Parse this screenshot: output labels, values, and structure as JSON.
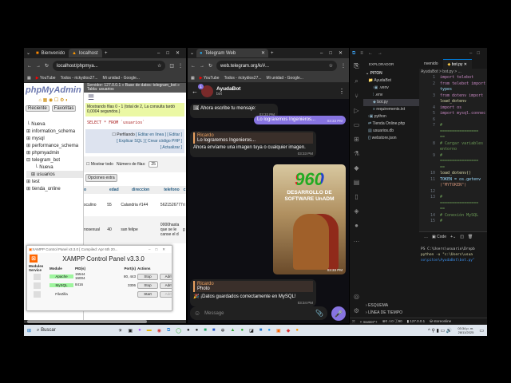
{
  "pma_window": {
    "tabs": [
      {
        "label": "Bienvenido"
      },
      {
        "label": "localhost"
      }
    ],
    "url": "localhost/phpmya...",
    "bookmarks": [
      "YouTube",
      "Todos - rickydios27...",
      "Mi unidad - Google..."
    ],
    "logo": "phpMyAdmin",
    "side_tabs": [
      "Reciente",
      "Favoritas"
    ],
    "tree": [
      "Nueva",
      "information_schema",
      "mysql",
      "performance_schema",
      "phpmyadmin",
      "telegram_bot",
      "Nueva",
      "usuarios",
      "test",
      "tienda_online"
    ],
    "breadcrumb": "Servidor: 127.0.0.1 » Base de datos: telegram_bot » Tabla: usuarios",
    "query_msg": "Mostrando filas 0 - 1 (total de 2, La consulta tardó 0,0004 segundos.)",
    "sql": "SELECT * FROM `usuarios`",
    "profiling": "Perfilando",
    "links": [
      "[ Editar en línea ]",
      "[ Editar ]",
      "[ Explicar SQL ]",
      "[ Crear código PHP ]",
      "[ Actualizar ]"
    ],
    "show_all": "Mostrar todo",
    "rows_label": "Número de filas:",
    "rows_value": "25",
    "extra_options": "Opciones extra",
    "columns": [
      "o",
      "edad",
      "direccion",
      "telefono",
      "c"
    ],
    "rows": [
      [
        "sculino",
        "55",
        "Calandria #144",
        "5621526777",
        "ri"
      ],
      [
        "nosexual",
        "40",
        "san felipe",
        "0000hasta que se le canse el d",
        "g"
      ]
    ]
  },
  "xampp": {
    "title": "XAMPP Control Panel v3.3.0   [ Compiled: Apr 6th 20...",
    "heading": "XAMPP Control Panel v3.3.0",
    "headers": [
      "Modules Service",
      "Module",
      "PID(s)",
      "Port(s)",
      "Actions"
    ],
    "rows": [
      {
        "module": "Apache",
        "pid": "15544\n16004",
        "ports": "80, 443",
        "action": "Stop",
        "admin": "Admin",
        "running": true
      },
      {
        "module": "MySQL",
        "pid": "8416",
        "ports": "3306",
        "action": "Stop",
        "admin": "Admin",
        "running": true
      },
      {
        "module": "FileZilla",
        "pid": "",
        "ports": "",
        "action": "Start",
        "admin": "Admin",
        "running": false
      }
    ]
  },
  "tg_window": {
    "tab": "Telegram Web",
    "url": "web.telegram.org/k/#...",
    "bookmarks": [
      "YouTube",
      "Todos - rickydios27...",
      "Mi unidad - Google..."
    ],
    "chat_name": "AyudaBot",
    "chat_status": "bot",
    "unread": "1",
    "messages": [
      {
        "text": "Ahora escribe tu mensaje:",
        "time": "03:33 PM"
      },
      {
        "text": "Lo lograremos Ingenieros...",
        "time": "03:33 PM"
      },
      {
        "reply_name": "Ricardo",
        "reply_text": "Lo lograremos Ingenieros...",
        "text": "Ahora envíame una imagen tuya o cualquier imagen.",
        "time": "03:33 PM"
      },
      {
        "image_title": "960",
        "image_caption": "DESARROLLO DE SOFTWARE UnADM",
        "time": "03:33 PM"
      },
      {
        "reply_name": "Ricardo",
        "reply_text": "Photo",
        "text": "¡Datos guardados correctamente en MySQL!",
        "time": "03:34 PM"
      }
    ],
    "input_placeholder": "Message"
  },
  "vscode": {
    "tabs": [
      "nvenido",
      "bot.py"
    ],
    "explorer_title": "EXPLORADOR",
    "root": "PITON",
    "tree": [
      "AyudaBot",
      ".venv",
      ".env",
      "bot.py",
      "requirements.txt",
      "python",
      "Tienda Online.php",
      "usuarios.db",
      "webstore.json"
    ],
    "breadcrumb": "AyudaBot > bot.py > ...",
    "code": [
      [
        "1",
        "import telebot"
      ],
      [
        "2",
        "from telebot import"
      ],
      [
        "",
        "types"
      ],
      [
        "3",
        "from dotenv import"
      ],
      [
        "",
        "load_dotenv"
      ],
      [
        "4",
        "import os"
      ],
      [
        "5",
        "import mysql.connec"
      ],
      [
        "6",
        ""
      ],
      [
        "7",
        "#"
      ],
      [
        "",
        "================"
      ],
      [
        "",
        "=="
      ],
      [
        "8",
        "# Cargar variables"
      ],
      [
        "",
        "entorno"
      ],
      [
        "9",
        "#"
      ],
      [
        "",
        "================"
      ],
      [
        "",
        "=="
      ],
      [
        "10",
        "load_dotenv()"
      ],
      [
        "11",
        "TOKEN = os.getenv"
      ],
      [
        "",
        "(\"MYTOKEN\")"
      ],
      [
        "12",
        ""
      ],
      [
        "13",
        "#"
      ],
      [
        "",
        "================"
      ],
      [
        "",
        "=="
      ],
      [
        "14",
        "# Conexión MySQL"
      ],
      [
        "15",
        "#"
      ]
    ],
    "terminal_tab": "Code",
    "terminal": [
      "PS C:\\Users\\usuario\\Dropb",
      "  python -u \"c:\\Users\\usua",
      "ox\\piton\\AyudaBot\\bot.py\""
    ],
    "outline": "ESQUEMA",
    "timeline": "LÍNEA DE TIEMPO",
    "status": {
      "branch": "master*+",
      "errors": "0",
      "warnings": "0",
      "info": "90",
      "host": "127.0.0.1",
      "db": "storeonline"
    }
  },
  "taskbar": {
    "search": "Buscar",
    "time": "03:34 p. m.",
    "date": "28/11/2025"
  }
}
